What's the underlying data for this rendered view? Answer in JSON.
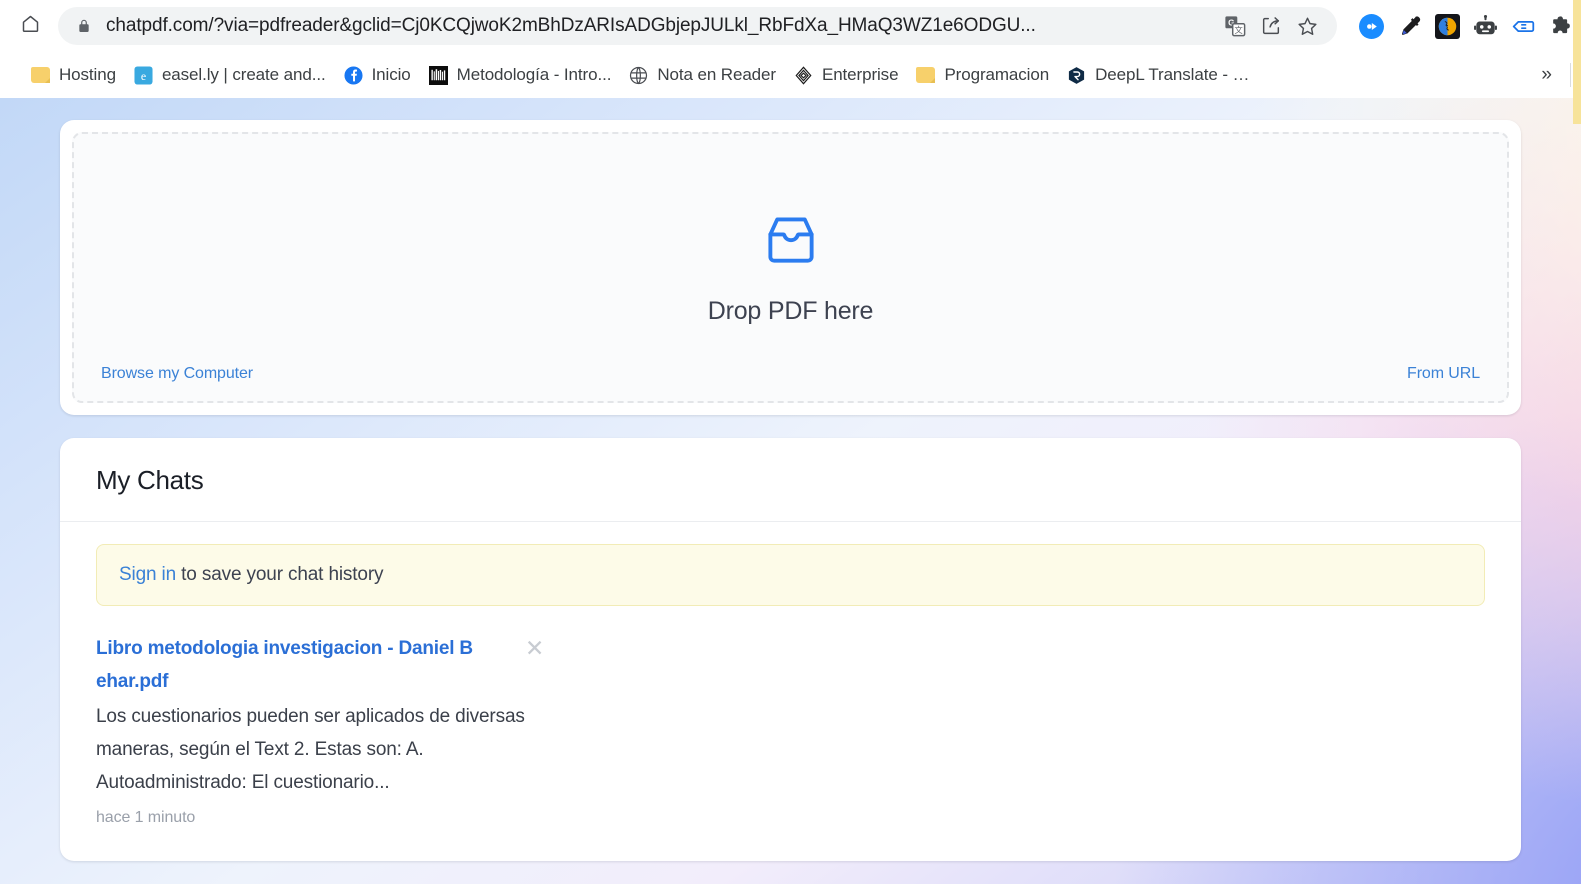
{
  "browser": {
    "home_icon": "home-icon",
    "lock_icon": "lock-icon",
    "url": "chatpdf.com/?via=pdfreader&gclid=Cj0KCQjwoK2mBhDzARIsADGbjepJULkl_RbFdXa_HMaQ3WZ1e6ODGU...",
    "omnibox_actions": [
      {
        "name": "google-translate-icon",
        "label": "Translate this page"
      },
      {
        "name": "share-icon",
        "label": "Share this page"
      },
      {
        "name": "star-icon",
        "label": "Bookmark this tab"
      }
    ],
    "extensions": [
      {
        "name": "blue-circle-extension-icon",
        "label": "Extension"
      },
      {
        "name": "eyedropper-icon",
        "label": "Color picker"
      },
      {
        "name": "brain-extension-icon",
        "label": "Extension"
      },
      {
        "name": "robot-icon",
        "label": "Extension"
      },
      {
        "name": "blue-tag-icon",
        "label": "Extension"
      },
      {
        "name": "puzzle-piece-icon",
        "label": "Extensions"
      }
    ],
    "bookmarks": [
      {
        "icon": "folder-icon",
        "label": "Hosting"
      },
      {
        "icon": "easelly-favicon",
        "label": "easel.ly | create and..."
      },
      {
        "icon": "facebook-favicon",
        "label": "Inicio"
      },
      {
        "icon": "metodologia-favicon",
        "label": "Metodología - Intro..."
      },
      {
        "icon": "globe-favicon",
        "label": "Nota en Reader"
      },
      {
        "icon": "enterprise-favicon",
        "label": "Enterprise"
      },
      {
        "icon": "folder-icon",
        "label": "Programacion"
      },
      {
        "icon": "deepl-favicon",
        "label": "DeepL Translate - El..."
      }
    ],
    "bookmarks_overflow": "»"
  },
  "upload": {
    "icon": "inbox-tray-icon",
    "drop_text": "Drop PDF here",
    "browse_label": "Browse my Computer",
    "from_url_label": "From URL"
  },
  "chats": {
    "title": "My Chats",
    "banner": {
      "link_text": "Sign in",
      "rest_text": " to save your chat history"
    },
    "items": [
      {
        "title": "Libro metodologia investigacion - Daniel B ehar.pdf",
        "close_icon": "close-icon",
        "snippet": "Los cuestionarios pueden ser aplicados de diversas maneras, según el Text 2. Estas son: A. Autoadministrado: El cuestionario...",
        "time": "hace 1 minuto"
      }
    ]
  },
  "colors": {
    "accent_blue": "#3b82d6",
    "link_blue": "#2b6fd6",
    "banner_bg": "#fdfbe8",
    "banner_border": "#f2ecb6",
    "drop_icon_blue": "#2b7cf0"
  }
}
